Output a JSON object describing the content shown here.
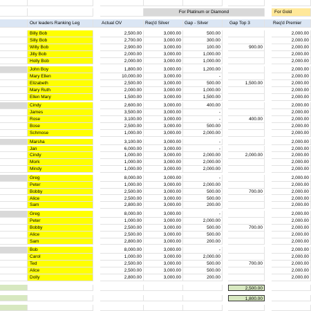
{
  "headers": {
    "platinum_diamond": "For Platinum or Diamond",
    "gold": "For Gold",
    "col_leg": "Our leaders Ranking Leg",
    "col_actual_ov": "Actual OV",
    "col_reqd_silver": "Req'd Silver",
    "col_gap_silver": "Gap - Silver",
    "col_gap_top3": "Gap Top 3",
    "col_reqd_premier": "Req'd Premier"
  },
  "groups": [
    {
      "rows": [
        {
          "name": "Billy Bob",
          "ov": "2,500.00",
          "silver": "3,000.00",
          "gap": "500.00",
          "top3": "",
          "premier": "2,000.00"
        },
        {
          "name": "Silly Bob",
          "ov": "2,700.00",
          "silver": "3,000.00",
          "gap": "300.00",
          "top3": "",
          "premier": "2,000.00"
        },
        {
          "name": "Willy Bob",
          "ov": "2,900.00",
          "silver": "3,000.00",
          "gap": "100.00",
          "top3": "900.00",
          "premier": "2,000.00"
        },
        {
          "name": "Jilly Bob",
          "ov": "2,000.00",
          "silver": "3,000.00",
          "gap": "1,000.00",
          "top3": "",
          "premier": "2,000.00"
        },
        {
          "name": "Holly Bob",
          "ov": "2,000.00",
          "silver": "3,000.00",
          "gap": "1,000.00",
          "top3": "",
          "premier": "2,000.00"
        }
      ]
    },
    {
      "rows": [
        {
          "name": "John Boy",
          "ov": "1,800.00",
          "silver": "3,000.00",
          "gap": "1,200.00",
          "top3": "",
          "premier": "2,000.00"
        },
        {
          "name": "Mary Ellen",
          "ov": "10,000.00",
          "silver": "3,000.00",
          "gap": "-",
          "top3": "",
          "premier": "2,000.00"
        },
        {
          "name": "Elizabeth",
          "ov": "2,500.00",
          "silver": "3,000.00",
          "gap": "500.00",
          "top3": "1,500.00",
          "premier": "2,000.00"
        },
        {
          "name": "Mary Ruth",
          "ov": "2,000.00",
          "silver": "3,000.00",
          "gap": "1,000.00",
          "top3": "",
          "premier": "2,000.00"
        },
        {
          "name": "Ellen Mary",
          "ov": "1,500.00",
          "silver": "3,000.00",
          "gap": "1,500.00",
          "top3": "",
          "premier": "2,000.00"
        }
      ]
    },
    {
      "rows": [
        {
          "name": "Cindy",
          "ov": "2,600.00",
          "silver": "3,000.00",
          "gap": "400.00",
          "top3": "",
          "premier": "2,000.00"
        },
        {
          "name": "James",
          "ov": "3,500.00",
          "silver": "3,000.00",
          "gap": "-",
          "top3": "",
          "premier": "2,000.00"
        },
        {
          "name": "Rose",
          "ov": "3,100.00",
          "silver": "3,000.00",
          "gap": "-",
          "top3": "400.00",
          "premier": "2,000.00"
        },
        {
          "name": "Bose",
          "ov": "2,500.00",
          "silver": "3,000.00",
          "gap": "500.00",
          "top3": "",
          "premier": "2,000.00"
        },
        {
          "name": "Schmose",
          "ov": "1,000.00",
          "silver": "3,000.00",
          "gap": "2,000.00",
          "top3": "",
          "premier": "2,000.00"
        }
      ]
    },
    {
      "rows": [
        {
          "name": "Marsha",
          "ov": "3,100.00",
          "silver": "3,000.00",
          "gap": "-",
          "top3": "",
          "premier": "2,000.00"
        },
        {
          "name": "Jan",
          "ov": "6,000.00",
          "silver": "3,000.00",
          "gap": "-",
          "top3": "",
          "premier": "2,000.00"
        },
        {
          "name": "Cindy",
          "ov": "1,000.00",
          "silver": "3,000.00",
          "gap": "2,000.00",
          "top3": "2,000.00",
          "premier": "2,000.00"
        },
        {
          "name": "Mork",
          "ov": "1,000.00",
          "silver": "3,000.00",
          "gap": "2,000.00",
          "top3": "",
          "premier": "2,000.00"
        },
        {
          "name": "Mindy",
          "ov": "1,000.00",
          "silver": "3,000.00",
          "gap": "2,000.00",
          "top3": "",
          "premier": "2,000.00"
        }
      ]
    },
    {
      "rows": [
        {
          "name": "Greg",
          "ov": "8,000.00",
          "silver": "3,000.00",
          "gap": "-",
          "top3": "",
          "premier": "2,000.00"
        },
        {
          "name": "Peter",
          "ov": "1,000.00",
          "silver": "3,000.00",
          "gap": "2,000.00",
          "top3": "",
          "premier": "2,000.00"
        },
        {
          "name": "Bobby",
          "ov": "2,500.00",
          "silver": "3,000.00",
          "gap": "500.00",
          "top3": "700.00",
          "premier": "2,000.00"
        },
        {
          "name": "Alice",
          "ov": "2,500.00",
          "silver": "3,000.00",
          "gap": "500.00",
          "top3": "",
          "premier": "2,000.00"
        },
        {
          "name": "Sam",
          "ov": "2,800.00",
          "silver": "3,000.00",
          "gap": "200.00",
          "top3": "",
          "premier": "2,000.00"
        }
      ]
    },
    {
      "rows": [
        {
          "name": "Greg",
          "ov": "8,000.00",
          "silver": "3,000.00",
          "gap": "-",
          "top3": "",
          "premier": "2,000.00"
        },
        {
          "name": "Peter",
          "ov": "1,000.00",
          "silver": "3,000.00",
          "gap": "2,000.00",
          "top3": "",
          "premier": "2,000.00"
        },
        {
          "name": "Bobby",
          "ov": "2,500.00",
          "silver": "3,000.00",
          "gap": "500.00",
          "top3": "700.00",
          "premier": "2,000.00"
        },
        {
          "name": "Alice",
          "ov": "2,500.00",
          "silver": "3,000.00",
          "gap": "500.00",
          "top3": "",
          "premier": "2,000.00"
        },
        {
          "name": "Sam",
          "ov": "2,800.00",
          "silver": "3,000.00",
          "gap": "200.00",
          "top3": "",
          "premier": "2,000.00"
        }
      ]
    },
    {
      "rows": [
        {
          "name": "Bob",
          "ov": "8,000.00",
          "silver": "3,000.00",
          "gap": "-",
          "top3": "",
          "premier": "2,000.00"
        },
        {
          "name": "Carol",
          "ov": "1,000.00",
          "silver": "3,000.00",
          "gap": "2,000.00",
          "top3": "",
          "premier": "2,000.00"
        },
        {
          "name": "Ted",
          "ov": "2,500.00",
          "silver": "3,000.00",
          "gap": "500.00",
          "top3": "700.00",
          "premier": "2,000.00"
        },
        {
          "name": "Alice",
          "ov": "2,500.00",
          "silver": "3,000.00",
          "gap": "500.00",
          "top3": "",
          "premier": "2,000.00"
        },
        {
          "name": "Dolly",
          "ov": "2,800.00",
          "silver": "3,000.00",
          "gap": "200.00",
          "top3": "",
          "premier": "2,000.00"
        }
      ]
    }
  ],
  "totals": {
    "gap_top3_1": "2,500.00",
    "gap_top3_2": "1,800.00"
  },
  "colors": {
    "leader_yellow": "#ffff00",
    "header_blue": "#dbe6f4",
    "header_gray": "#d9d9d9",
    "gold_header": "#ffe89a",
    "total_green": "#d7e8c0"
  }
}
